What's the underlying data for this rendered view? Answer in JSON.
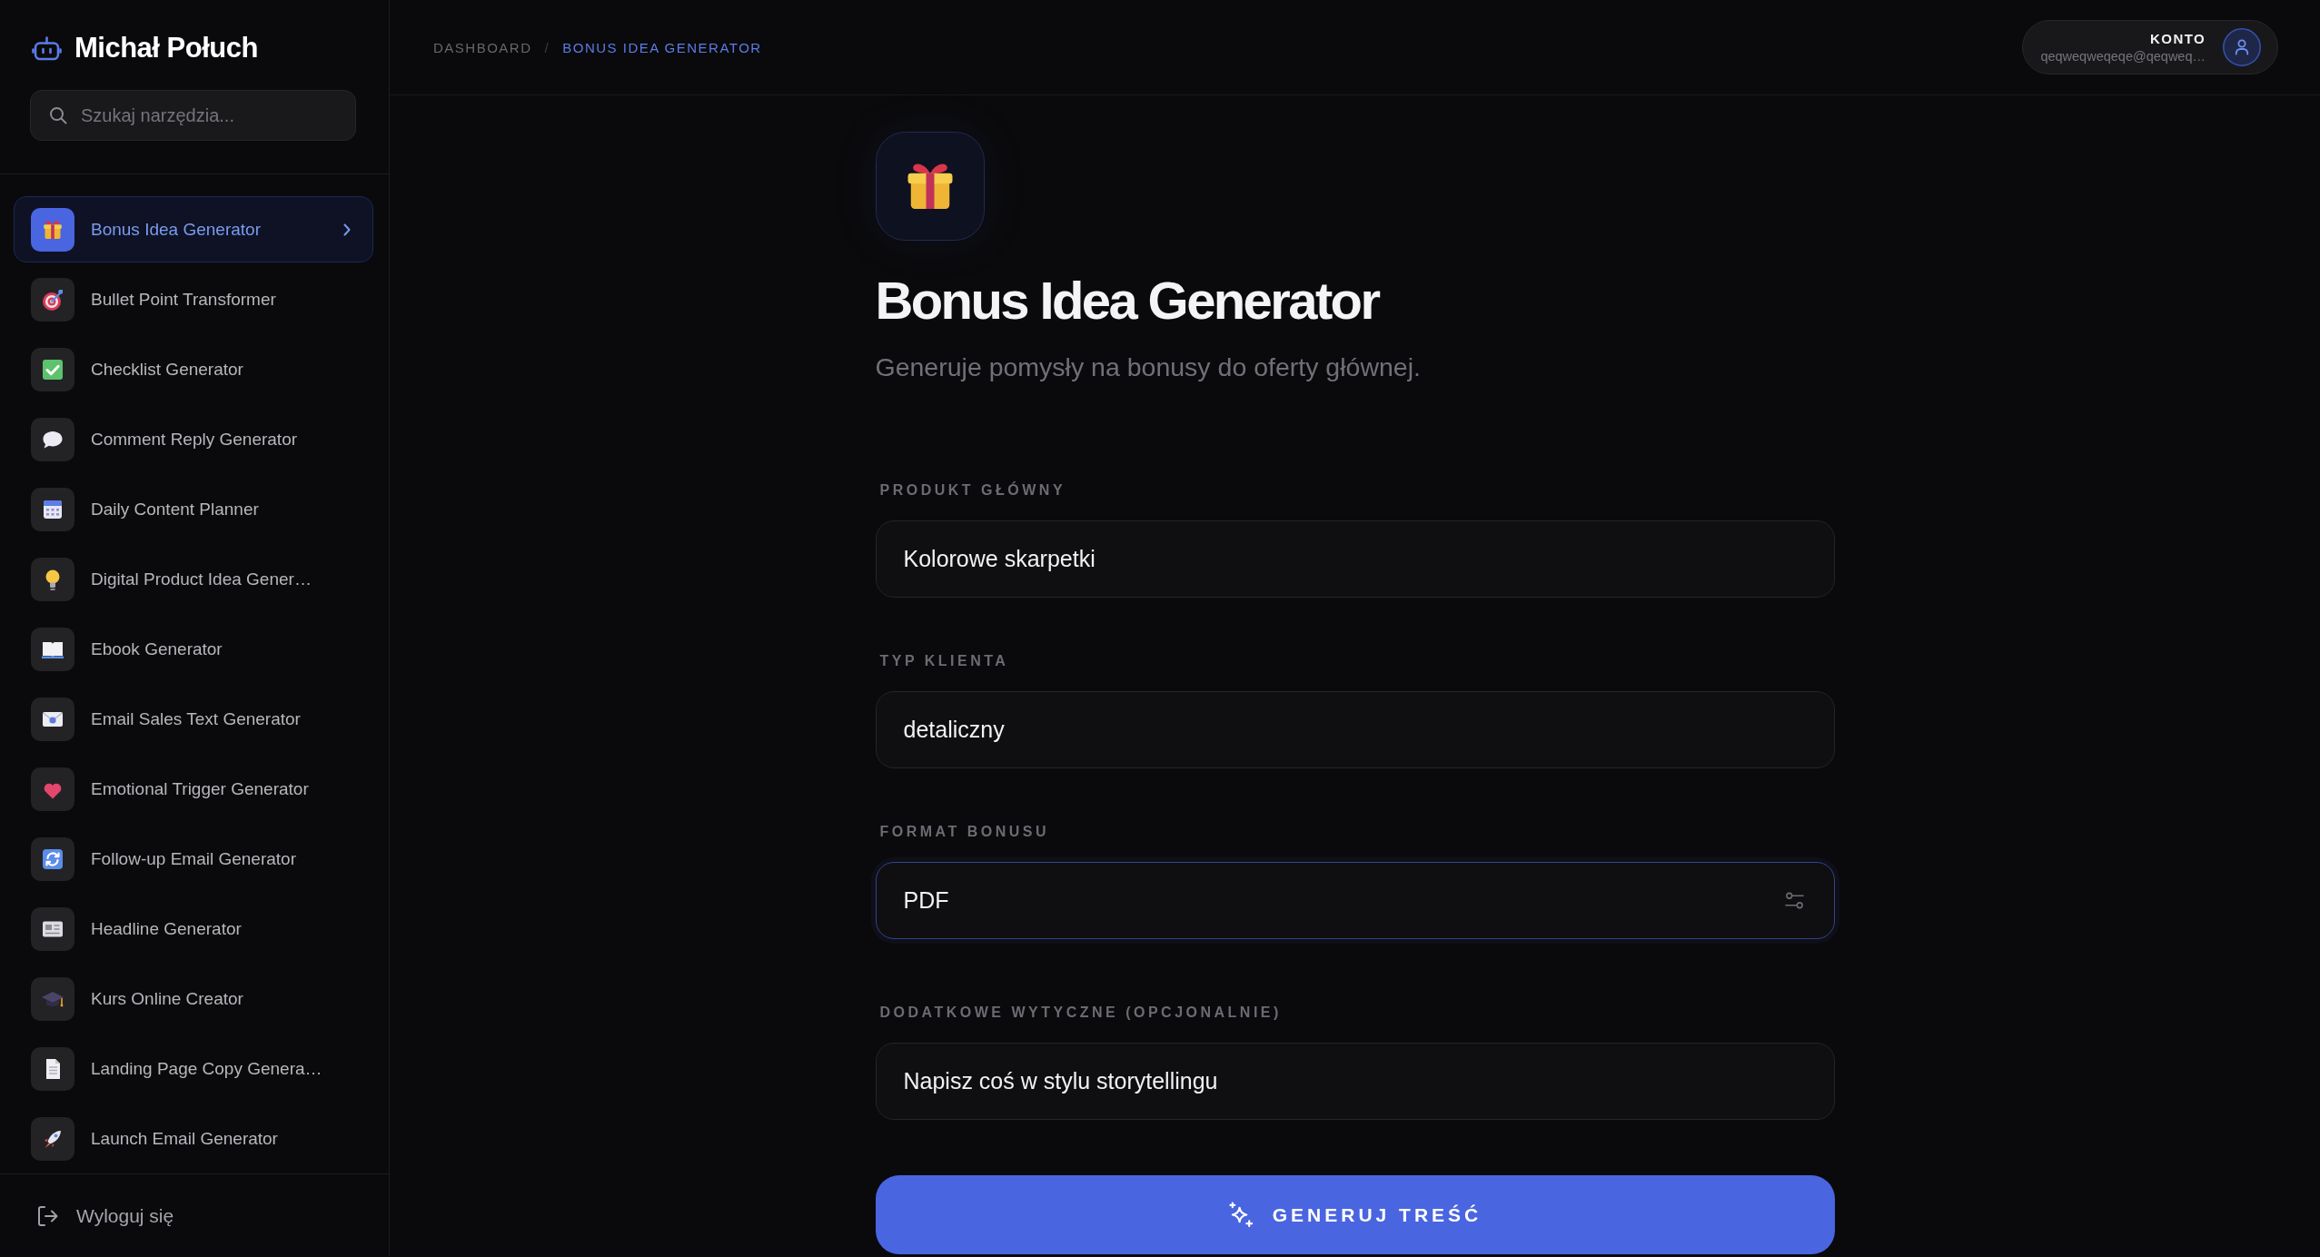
{
  "sidebar": {
    "brand": "Michał Połuch",
    "search": {
      "placeholder": "Szukaj narzędzia..."
    },
    "items": [
      {
        "label": "Bonus Idea Generator",
        "selected": true
      },
      {
        "label": "Bullet Point Transformer",
        "selected": false
      },
      {
        "label": "Checklist Generator",
        "selected": false
      },
      {
        "label": "Comment Reply Generator",
        "selected": false
      },
      {
        "label": "Daily Content Planner",
        "selected": false
      },
      {
        "label": "Digital Product Idea Gener…",
        "selected": false
      },
      {
        "label": "Ebook Generator",
        "selected": false
      },
      {
        "label": "Email Sales Text Generator",
        "selected": false
      },
      {
        "label": "Emotional Trigger Generator",
        "selected": false
      },
      {
        "label": "Follow-up Email Generator",
        "selected": false
      },
      {
        "label": "Headline Generator",
        "selected": false
      },
      {
        "label": "Kurs Online Creator",
        "selected": false
      },
      {
        "label": "Landing Page Copy Genera…",
        "selected": false
      },
      {
        "label": "Launch Email Generator",
        "selected": false
      }
    ],
    "logout": "Wyloguj się"
  },
  "header": {
    "breadcrumbs": [
      {
        "label": "DASHBOARD",
        "current": false
      },
      {
        "label": "BONUS IDEA GENERATOR",
        "current": true
      }
    ],
    "separator": "/",
    "account": {
      "label": "KONTO",
      "email": "qeqweqweqeqe@qeqweq…"
    }
  },
  "page": {
    "title": "Bonus Idea Generator",
    "subtitle": "Generuje pomysły na bonusy do oferty głównej."
  },
  "form": {
    "fields": [
      {
        "label": "PRODUKT GŁÓWNY",
        "value": "Kolorowe skarpetki",
        "kind": "text",
        "focused": false
      },
      {
        "label": "TYP KLIENTA",
        "value": "detaliczny",
        "kind": "text",
        "focused": false
      },
      {
        "label": "FORMAT BONUSU",
        "value": "PDF",
        "kind": "options",
        "focused": true
      },
      {
        "label": "DODATKOWE WYTYCZNE (OPCJONALNIE)",
        "value": "Napisz coś w stylu storytellingu",
        "kind": "text",
        "focused": false
      }
    ],
    "submit": "GENERUJ TREŚĆ"
  }
}
